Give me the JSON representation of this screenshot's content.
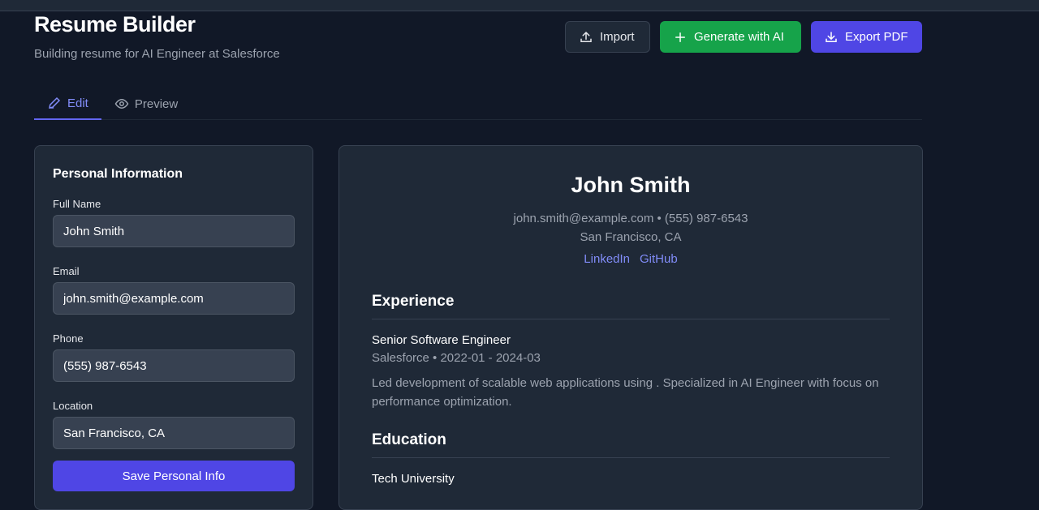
{
  "header": {
    "title": "Resume Builder",
    "subtitle": "Building resume for AI Engineer at Salesforce"
  },
  "actions": {
    "import": "Import",
    "generate": "Generate with AI",
    "export": "Export PDF"
  },
  "tabs": [
    {
      "label": "Edit"
    },
    {
      "label": "Preview"
    }
  ],
  "form": {
    "title": "Personal Information",
    "fields": [
      {
        "label": "Full Name",
        "value": "John Smith"
      },
      {
        "label": "Email",
        "value": "john.smith@example.com"
      },
      {
        "label": "Phone",
        "value": "(555) 987-6543"
      },
      {
        "label": "Location",
        "value": "San Francisco, CA"
      }
    ],
    "save": "Save Personal Info"
  },
  "preview": {
    "name": "John Smith",
    "contact_line": "john.smith@example.com • (555) 987-6543",
    "location": "San Francisco, CA",
    "links": [
      "LinkedIn",
      "GitHub"
    ],
    "experience_title": "Experience",
    "experience": {
      "role": "Senior Software Engineer",
      "meta": "Salesforce • 2022-01 - 2024-03",
      "description": "Led development of scalable web applications using . Specialized in AI Engineer with focus on performance optimization."
    },
    "education_title": "Education",
    "education": {
      "school": "Tech University"
    }
  }
}
